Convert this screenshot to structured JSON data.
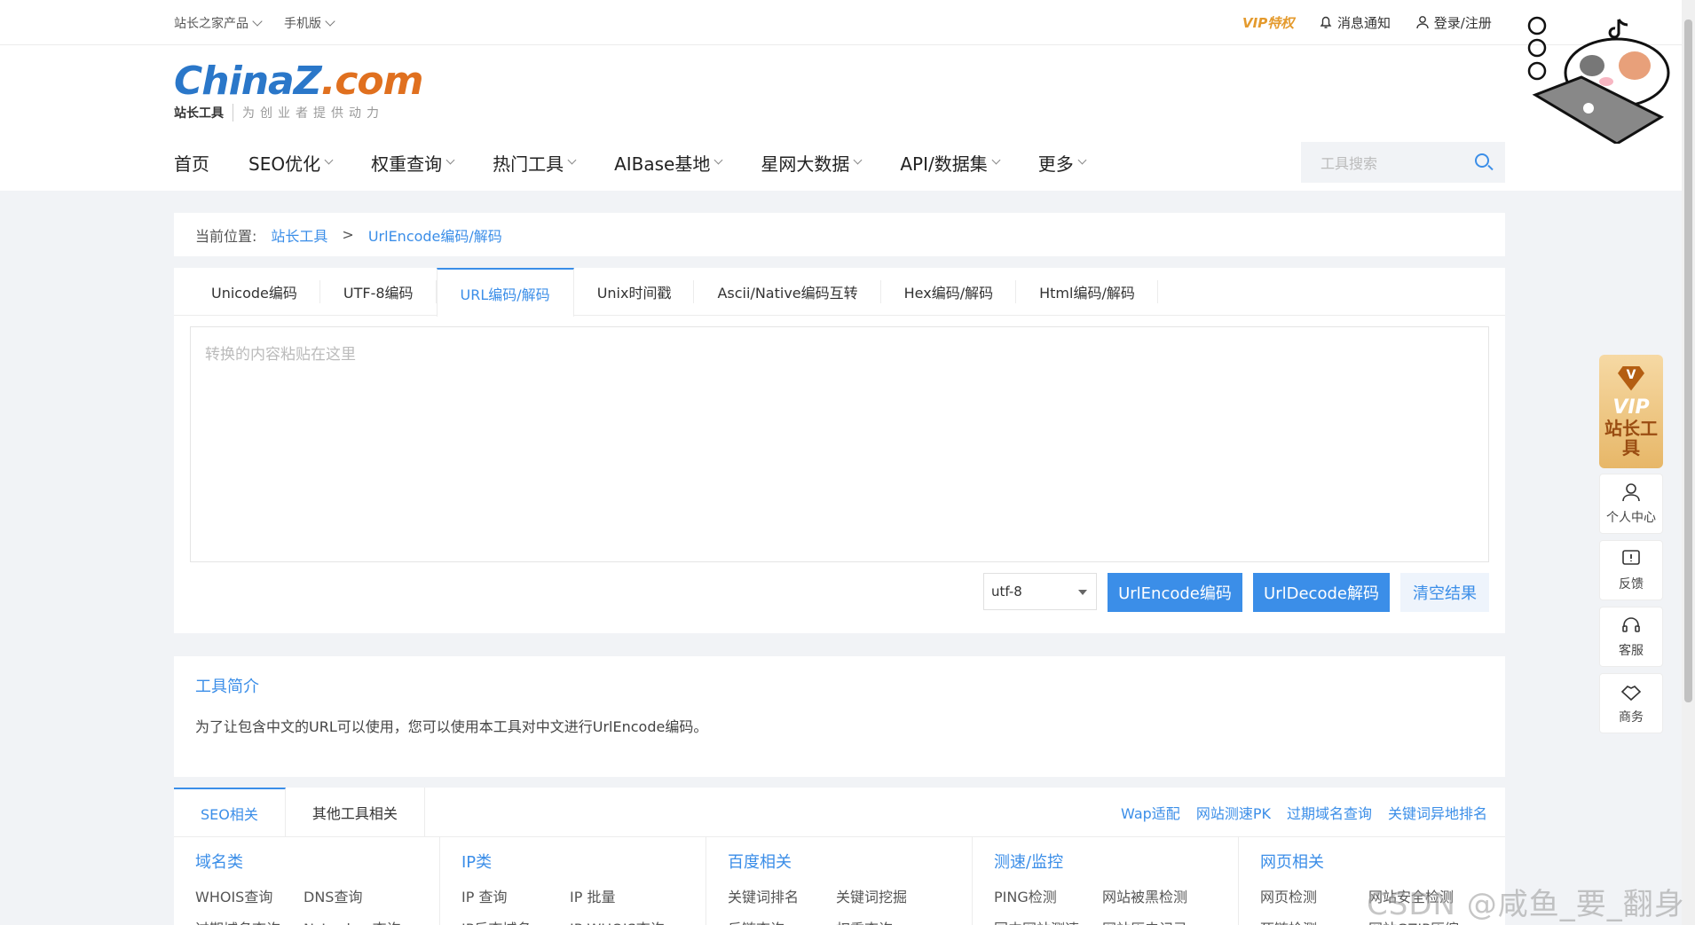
{
  "topbar": {
    "products": "站长之家产品",
    "mobile": "手机版",
    "vip": "VIP特权",
    "messages": "消息通知",
    "login": "登录/注册"
  },
  "logo": {
    "main_a": "China",
    "main_z": "Z",
    "main_com": ".com",
    "sub1": "站长工具",
    "sub2": "为创业者提供动力"
  },
  "nav": [
    "首页",
    "SEO优化",
    "权重查询",
    "热门工具",
    "AIBase基地",
    "星网大数据",
    "API/数据集",
    "更多"
  ],
  "search": {
    "placeholder": "工具搜索"
  },
  "breadcrumb": {
    "label": "当前位置:",
    "home": "站长工具",
    "sep": ">",
    "current": "UrlEncode编码/解码"
  },
  "tabs": [
    "Unicode编码",
    "UTF-8编码",
    "URL编码/解码",
    "Unix时间戳",
    "Ascii/Native编码互转",
    "Hex编码/解码",
    "Html编码/解码"
  ],
  "input": {
    "placeholder": "转换的内容粘贴在这里"
  },
  "actions": {
    "encoding": "utf-8",
    "encode": "UrlEncode编码",
    "decode": "UrlDecode解码",
    "clear": "清空结果"
  },
  "intro": {
    "title": "工具简介",
    "text": "为了让包含中文的URL可以使用，您可以使用本工具对中文进行UrlEncode编码。"
  },
  "related": {
    "tabs": [
      "SEO相关",
      "其他工具相关"
    ],
    "links": [
      "Wap适配",
      "网站测速PK",
      "过期域名查询",
      "关键词异地排名"
    ],
    "columns": [
      {
        "title": "域名类",
        "items": [
          "WHOIS查询",
          "DNS查询"
        ],
        "items2": [
          "过期域名查询",
          "NsLookup查询"
        ]
      },
      {
        "title": "IP类",
        "items": [
          "IP 查询",
          "IP 批量"
        ],
        "items2": [
          "IP反查域名",
          "IP WHOIS查询"
        ]
      },
      {
        "title": "百度相关",
        "items": [
          "关键词排名",
          "关键词挖掘"
        ],
        "items2": [
          "反链查询",
          "权重查询"
        ]
      },
      {
        "title": "测速/监控",
        "items": [
          "PING检测",
          "网站被黑检测"
        ],
        "items2": [
          "国内网站测速",
          "网站历史记录"
        ]
      },
      {
        "title": "网页相关",
        "items": [
          "网页检测",
          "网站安全检测"
        ],
        "items2": [
          "死链检测",
          "网站GZIP压缩"
        ]
      }
    ]
  },
  "sidebar": {
    "vip_v": "V",
    "vip_t1": "VIP",
    "vip_t2": "站长工具",
    "buttons": [
      "个人中心",
      "反馈",
      "客服",
      "商务"
    ]
  },
  "watermark": "CSDN @咸鱼_要_翻身"
}
